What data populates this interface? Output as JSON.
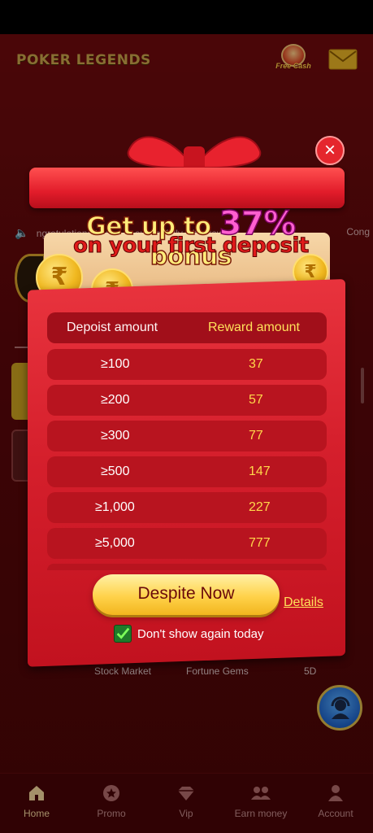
{
  "app": {
    "brand": "POKER LEGENDS",
    "free_cash": "Free Cash",
    "marquee_left": "ngratulations to use     fo sucessfully withdrawing",
    "marquee_right": "Cong",
    "games": [
      "Stock Market",
      "Fortune Gems",
      "5D"
    ]
  },
  "popup": {
    "headline_pre": "Get up to ",
    "headline_pct": "37%",
    "headline_post": " bonus",
    "subhead": "on your first deposit",
    "close": "×",
    "table": {
      "col_deposit": "Depoist amount",
      "col_reward": "Reward amount",
      "rows": [
        {
          "deposit": "≥100",
          "reward": "37"
        },
        {
          "deposit": "≥200",
          "reward": "57"
        },
        {
          "deposit": "≥300",
          "reward": "77"
        },
        {
          "deposit": "≥500",
          "reward": "147"
        },
        {
          "deposit": "≥1,000",
          "reward": "227"
        },
        {
          "deposit": "≥5,000",
          "reward": "777"
        }
      ]
    },
    "deposit_button": "Despite Now",
    "details": "Details",
    "dont_show": "Don't show again today",
    "dont_show_checked": true
  },
  "nav": {
    "items": [
      {
        "label": "Home",
        "icon": "home-icon",
        "active": true
      },
      {
        "label": "Promo",
        "icon": "promo-icon",
        "active": false
      },
      {
        "label": "Vip",
        "icon": "vip-icon",
        "active": false
      },
      {
        "label": "Earn money",
        "icon": "earn-money-icon",
        "active": false
      },
      {
        "label": "Account",
        "icon": "account-icon",
        "active": false
      }
    ]
  },
  "colors": {
    "background": "#5a0709",
    "accent_gold": "#ffd24a",
    "card_red": "#d51f2c",
    "row_red": "#b8141f",
    "nav_active": "#f2d59b"
  }
}
